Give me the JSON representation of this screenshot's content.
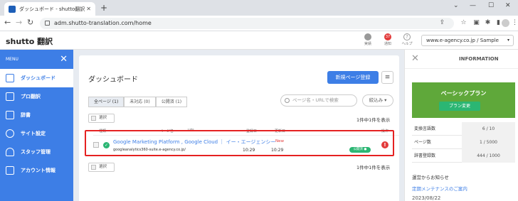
{
  "browser": {
    "tab_title": "ダッシュボード - shutto翻訳",
    "tab_close": "✕",
    "new_tab": "+",
    "url": "adm.shutto-translation.com/home"
  },
  "header": {
    "logo": "shutto 翻訳",
    "icons": [
      {
        "name": "status",
        "label": "実績"
      },
      {
        "name": "notice",
        "label": "通知",
        "badge": "37"
      },
      {
        "name": "help",
        "label": "ヘルプ"
      }
    ],
    "site_select": "www.e-agency.co.jp / Sample"
  },
  "sidebar": {
    "menu_label": "MENU",
    "items": [
      {
        "label": "ダッシュボード",
        "active": true
      },
      {
        "label": "プロ翻訳",
        "active": false
      },
      {
        "label": "辞書",
        "active": false
      },
      {
        "label": "サイト設定",
        "active": false
      },
      {
        "label": "スタッフ管理",
        "active": false
      },
      {
        "label": "アカウント情報",
        "active": false
      }
    ]
  },
  "main": {
    "title": "ダッシュボード",
    "new_page_button": "新規ページ登録",
    "menu_button": "≡",
    "filter_tabs": [
      "全ページ (1)",
      "未対応 (0)",
      "公開済 (1)"
    ],
    "search_placeholder": "ページ名・URLで検索",
    "narrow_label": "絞込み",
    "select_label": "選択",
    "count_text": "1件中1件を表示",
    "columns": [
      "種類",
      "ページ名",
      "URL",
      "登録日",
      "更新日",
      "操作"
    ],
    "rows": [
      {
        "title": "Google Marketing Platform , Google Cloud ｜ イー・エージェンシー",
        "new_badge": "New",
        "url": "googleanalytics360-suite.e-agency.co.jp/",
        "registered": "10:29",
        "updated": "10:29",
        "status": "公開済 ●",
        "alert": "!"
      }
    ]
  },
  "info": {
    "title": "INFORMATION",
    "plan_name": "ベーシックプラン",
    "plan_button": "プラン変更",
    "stats": [
      {
        "label": "変換言語数",
        "value": "6 / 10"
      },
      {
        "label": "ページ数",
        "value": "1 / 5000"
      },
      {
        "label": "辞書登録数",
        "value": "444 / 1000"
      }
    ],
    "notice_heading": "運営からお知らせ",
    "notice_link": "定期メンテナンスのご案内",
    "notice_date": "2023/08/22"
  }
}
